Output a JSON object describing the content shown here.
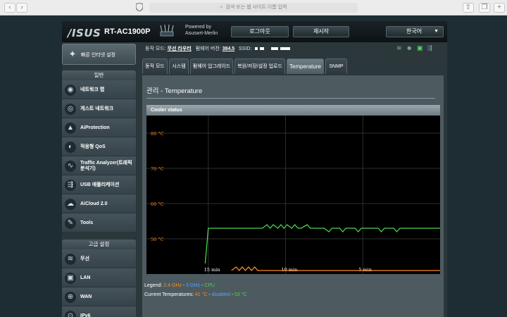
{
  "browser": {
    "address_placeholder": "검색 또는 웹 사이트 이름 입력",
    "back_icon": "‹",
    "forward_icon": "›",
    "shield_icon": "shield-icon"
  },
  "header": {
    "logo": "/ISUS",
    "model": "RT-AC1900P",
    "powered_line1": "Powered by",
    "powered_line2": "Asuswrt-Merlin",
    "logout": "로그아웃",
    "reboot": "재시작",
    "language": "한국어"
  },
  "sidebar": {
    "quick_setup": "빠른 인터넷 설정",
    "general_title": "일반",
    "general_items": [
      {
        "label": "네트워크 맵",
        "icon": "network-map-icon",
        "glyph": "◉"
      },
      {
        "label": "게스트 네트워크",
        "icon": "guest-network-icon",
        "glyph": "◎"
      },
      {
        "label": "AiProtection",
        "icon": "aiprotection-icon",
        "glyph": "▲"
      },
      {
        "label": "적응형 QoS",
        "icon": "qos-gauge-icon",
        "glyph": "◐"
      },
      {
        "label": "Traffic Analyzer(트래픽분석기)",
        "icon": "traffic-analyzer-icon",
        "glyph": "∿"
      },
      {
        "label": "USB 애플리케이션",
        "icon": "usb-icon",
        "glyph": "⇶"
      },
      {
        "label": "AiCloud 2.0",
        "icon": "cloud-icon",
        "glyph": "☁"
      },
      {
        "label": "Tools",
        "icon": "tools-icon",
        "glyph": "✎"
      }
    ],
    "advanced_title": "고급 설정",
    "advanced_items": [
      {
        "label": "무선",
        "icon": "wireless-icon",
        "glyph": "≋"
      },
      {
        "label": "LAN",
        "icon": "lan-icon",
        "glyph": "▣"
      },
      {
        "label": "WAN",
        "icon": "wan-icon",
        "glyph": "⊕"
      },
      {
        "label": "IPv6",
        "icon": "ipv6-icon",
        "glyph": "⊙"
      }
    ]
  },
  "status": {
    "mode_label": "동작 모드:",
    "mode_value": "무선 라우터",
    "fw_label": "펌웨어 버전:",
    "fw_value": "384.5",
    "ssid_label": "SSID:"
  },
  "tabs": [
    "동작 모드",
    "시스템",
    "펌웨어 업그레이드",
    "복원/저장/설정 업로드",
    "Temperature",
    "SNMP"
  ],
  "active_tab": "Temperature",
  "panel": {
    "title": "관리 - Temperature",
    "cooler_header": "Cooler status"
  },
  "legend": {
    "prefix": "Legend:",
    "ghz24": "2.4 GHz",
    "sep1": " - ",
    "ghz5": "5 GHz",
    "sep2": " - ",
    "cpu": "CPU"
  },
  "current": {
    "prefix": "Current Temperatures:",
    "v24": "41 °C",
    "sep1": " - ",
    "v5": "disabled",
    "sep2": " - ",
    "vcpu": "53 °C"
  },
  "colors": {
    "ghz24": "#ff8a1e",
    "ghz5": "#4ea6ff",
    "cpu": "#4cd34c",
    "grid": "#2e2e2e"
  },
  "chart_data": {
    "type": "line",
    "title": "",
    "xlabel": "",
    "ylabel": "",
    "y_ticks": [
      "80 °C",
      "70 °C",
      "60 °C",
      "50 °C"
    ],
    "y_tick_values": [
      80,
      70,
      60,
      50
    ],
    "x_ticks": [
      "15 min",
      "10 min",
      "5 min"
    ],
    "x_tick_values": [
      15,
      10,
      5
    ],
    "xlim": [
      19,
      0
    ],
    "ylim": [
      40,
      85
    ],
    "series": [
      {
        "name": "CPU",
        "color": "#4cd34c",
        "x": [
          15.2,
          15.0,
          11.5,
          11.2,
          11.0,
          10.8,
          10.5,
          10.3,
          10.1,
          9.9,
          9.6,
          9.4,
          9.2,
          9.0,
          8.6,
          8.4,
          8.2,
          7.5,
          7.2,
          7.0,
          6.5,
          6.3,
          6.1,
          5.5,
          5.3,
          5.1,
          4.0,
          3.8,
          3.6,
          3.0,
          2.8,
          2.6,
          0
        ],
        "y": [
          43,
          53,
          53,
          54,
          53,
          54,
          53,
          54,
          53,
          54,
          53,
          54,
          53,
          53,
          54,
          53,
          53,
          53,
          52,
          53,
          53,
          52,
          53,
          53,
          52,
          53,
          53,
          52,
          53,
          53,
          52,
          53,
          53
        ]
      },
      {
        "name": "2.4 GHz",
        "color": "#ff8a1e",
        "x": [
          13.5,
          13.2,
          13.0,
          12.8,
          12.6,
          12.4,
          12.2,
          12.0,
          11.8,
          11.6,
          11.4,
          0
        ],
        "y": [
          41,
          42,
          41,
          42,
          41,
          42,
          41,
          42,
          41,
          41,
          41,
          41
        ]
      }
    ]
  }
}
